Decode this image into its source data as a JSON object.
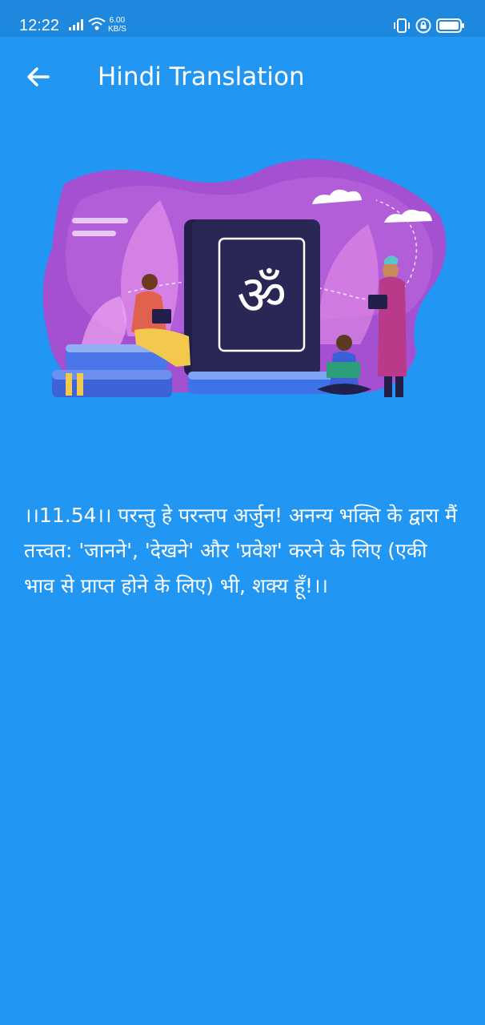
{
  "status_bar": {
    "time": "12:22",
    "speed_value": "6.00",
    "speed_unit": "KB/S",
    "icons": [
      "signal-icon",
      "wifi-icon",
      "vibrate-icon",
      "lock-icon",
      "battery-icon"
    ]
  },
  "app_bar": {
    "title": "Hindi Translation",
    "back_icon": "arrow-left-icon"
  },
  "illustration": {
    "icon": "om-symbol-book",
    "colors": {
      "purple": "#A34FCF",
      "book": "#24214F",
      "books_blue": "#3E72E8"
    }
  },
  "content": {
    "verse_text": "।।11.54।। परन्तु हे परन्तप अर्जुन! अनन्य भक्ति के द्वारा मैं तत्त्वत: 'जानने', 'देखने' और 'प्रवेश' करने के लिए (एकी भाव से प्राप्त होने के लिए) भी, शक्य हूँ!।।"
  },
  "colors": {
    "background": "#2196F3",
    "status_bar": "#1E88DF",
    "text": "#FFFFFF"
  }
}
